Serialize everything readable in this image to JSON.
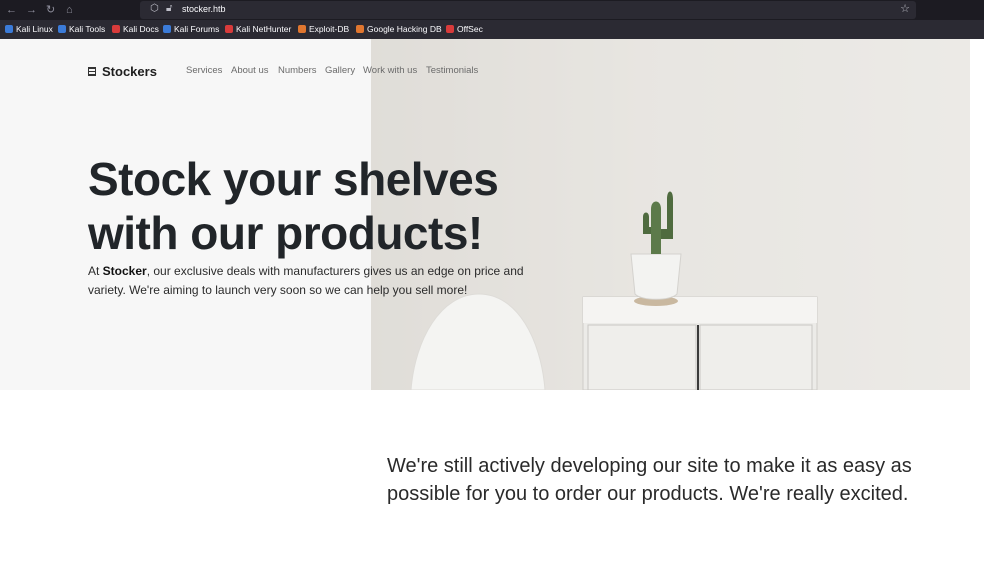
{
  "browser": {
    "url": "stocker.htb",
    "bookmarks": [
      {
        "label": "Kali Linux",
        "color": "#3b7bd8"
      },
      {
        "label": "Kali Tools",
        "color": "#3b7bd8"
      },
      {
        "label": "Kali Docs",
        "color": "#d83b3b"
      },
      {
        "label": "Kali Forums",
        "color": "#3b7bd8"
      },
      {
        "label": "Kali NetHunter",
        "color": "#d83b3b"
      },
      {
        "label": "Exploit-DB",
        "color": "#e0762f"
      },
      {
        "label": "Google Hacking DB",
        "color": "#e0762f"
      },
      {
        "label": "OffSec",
        "color": "#d83b3b"
      }
    ]
  },
  "site": {
    "logo": "Stockers",
    "nav": [
      "Services",
      "About us",
      "Numbers",
      "Gallery",
      "Work with us",
      "Testimonials"
    ],
    "hero_title_line1": "Stock your shelves",
    "hero_title_line2": "with our products!",
    "hero_text_prefix": "At ",
    "hero_text_brand": "Stocker",
    "hero_text_rest": ", our exclusive deals with manufacturers gives us an edge on price and variety. We're aiming to launch very soon so we can help you sell more!",
    "lower_text": "We're still actively developing our site to make it as easy as possible for you to order our products. We're really excited."
  },
  "colors": {
    "browser_bg": "#1c1b22",
    "hero_bg": "#f7f7f7",
    "text_dark": "#212529"
  }
}
